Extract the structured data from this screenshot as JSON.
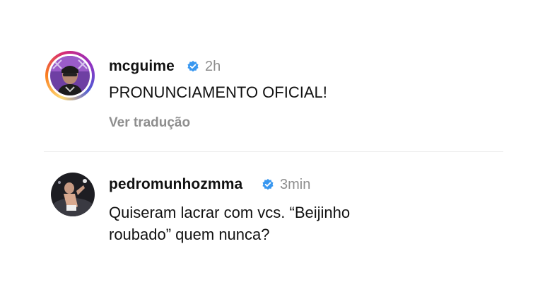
{
  "caption": {
    "username": "mcguime",
    "time": "2h",
    "text": "PRONUNCIAMENTO OFICIAL!",
    "translate_label": "Ver tradução"
  },
  "reply": {
    "username": "pedromunhozmma",
    "time": "3min",
    "text_line1": "Quiseram lacrar com vcs. “Beijinho",
    "text_line2": "roubado” quem nunca?"
  },
  "colors": {
    "verified_blue": "#3897f0",
    "secondary_text": "#8e8e8e",
    "primary_text": "#111111"
  }
}
